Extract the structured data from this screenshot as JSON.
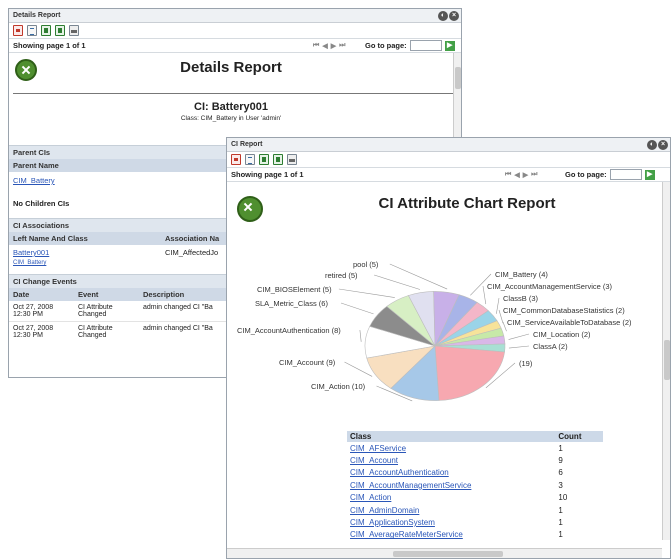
{
  "details": {
    "window_title": "Details Report",
    "pager": {
      "showing": "Showing page",
      "page": "1",
      "of": "of",
      "total": "1",
      "goto_label": "Go to page:"
    },
    "title": "Details Report",
    "ci_title": "CI: Battery001",
    "ci_subtitle": "Class: CIM_Battery in User 'admin'",
    "parent_section": "Parent CIs",
    "parent_header": "Parent Name",
    "parent_item": "CIM_Battery",
    "children_text": "No Children CIs",
    "assoc_section": "CI Associations",
    "assoc_col1": "Left Name And Class",
    "assoc_col2": "Association Na",
    "assoc_row1_name": "Battery001",
    "assoc_row1_class": "CIM_Battery",
    "assoc_row1_assoc": "CIM_AffectedJo",
    "events_section": "CI Change Events",
    "events_cols": [
      "Date",
      "Event",
      "Description"
    ],
    "events": [
      {
        "date1": "Oct 27, 2008",
        "date2": "12:30 PM",
        "ev1": "CI Attribute",
        "ev2": "Changed",
        "desc": "admin changed CI \"Ba"
      },
      {
        "date1": "Oct 27, 2008",
        "date2": "12:30 PM",
        "ev1": "CI Attribute",
        "ev2": "Changed",
        "desc": "admin changed CI \"Ba"
      }
    ]
  },
  "chart_window": {
    "window_title": "CI Report",
    "pager": {
      "showing": "Showing page",
      "page": "1",
      "of": "of",
      "total": "1",
      "goto_label": "Go to page:"
    },
    "title": "CI Attribute Chart Report",
    "table_headers": [
      "Class",
      "Count"
    ],
    "table_rows": [
      {
        "cls": "CIM_AFService",
        "count": "1"
      },
      {
        "cls": "CIM_Account",
        "count": "9"
      },
      {
        "cls": "CIM_AccountAuthentication",
        "count": "6"
      },
      {
        "cls": "CIM_AccountManagementService",
        "count": "3"
      },
      {
        "cls": "CIM_Action",
        "count": "10"
      },
      {
        "cls": "CIM_AdminDomain",
        "count": "1"
      },
      {
        "cls": "CIM_ApplicationSystem",
        "count": "1"
      },
      {
        "cls": "CIM_AverageRateMeterService",
        "count": "1"
      }
    ]
  },
  "chart_data": {
    "type": "pie",
    "title": "CI Attribute Chart Report",
    "slices": [
      {
        "label": "CIM_Battery",
        "value": 4,
        "display": "CIM_Battery (4)",
        "color": "#a8b4e8"
      },
      {
        "label": "CIM_AccountManagementService",
        "value": 3,
        "display": "CIM_AccountManagementService (3)",
        "color": "#f4b6c8"
      },
      {
        "label": "ClassB",
        "value": 3,
        "display": "ClassB (3)",
        "color": "#9ad4e8"
      },
      {
        "label": "CIM_CommonDatabaseStatistics",
        "value": 2,
        "display": "CIM_CommonDatabaseStatistics (2)",
        "color": "#f7e39a"
      },
      {
        "label": "CIM_ServiceAvailableToDatabase",
        "value": 2,
        "display": "CIM_ServiceAvailableToDatabase (2)",
        "color": "#c7e9a8"
      },
      {
        "label": "CIM_Location",
        "value": 2,
        "display": "CIM_Location (2)",
        "color": "#d9b8e8"
      },
      {
        "label": "ClassA",
        "value": 2,
        "display": "ClassA (2)",
        "color": "#a8e0d4"
      },
      {
        "label": "",
        "value": 19,
        "display": "(19)",
        "color": "#f7a8b0"
      },
      {
        "label": "CIM_Action",
        "value": 10,
        "display": "CIM_Action (10)",
        "color": "#a6c8e8"
      },
      {
        "label": "CIM_Account",
        "value": 9,
        "display": "CIM_Account (9)",
        "color": "#f8dfc0"
      },
      {
        "label": "CIM_AccountAuthentication",
        "value": 8,
        "display": "CIM_AccountAuthentication (8)",
        "color": "#ffffff"
      },
      {
        "label": "SLA_Metric_Class",
        "value": 6,
        "display": "SLA_Metric_Class (6)",
        "color": "#8c8c8c"
      },
      {
        "label": "CIM_BIOSElement",
        "value": 5,
        "display": "CIM_BIOSElement (5)",
        "color": "#d7efc4"
      },
      {
        "label": "retired",
        "value": 5,
        "display": "retired (5)",
        "color": "#e0e0f0"
      },
      {
        "label": "pool",
        "value": 5,
        "display": "pool (5)",
        "color": "#c8b0e8"
      }
    ]
  },
  "icons": {
    "close": "close-icon",
    "restore": "restore-icon",
    "logo": "app-logo-icon"
  }
}
